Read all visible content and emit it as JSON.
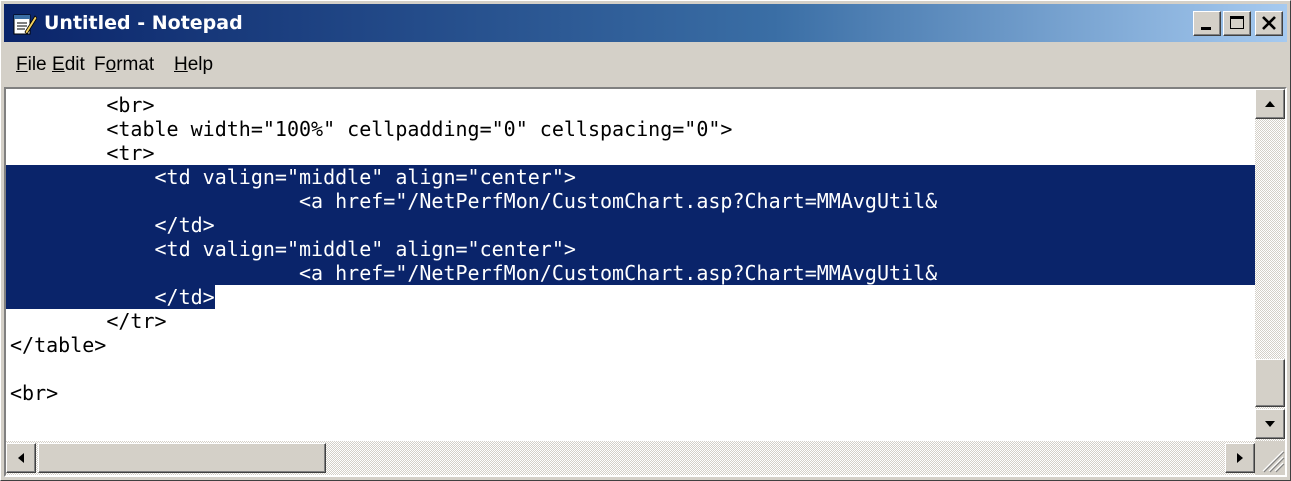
{
  "window": {
    "title": "Untitled - Notepad",
    "icon": "notepad-icon",
    "controls": [
      "minimize-icon",
      "maximize-icon",
      "close-icon"
    ]
  },
  "menu": {
    "file": {
      "mnemonic": "F",
      "rest": "ile"
    },
    "edit": {
      "mnemonic": "E",
      "rest": "dit"
    },
    "format": {
      "pre": "F",
      "mnemonic": "o",
      "rest": "rmat"
    },
    "help": {
      "mnemonic": "H",
      "rest": "elp"
    }
  },
  "editor": {
    "lines": [
      {
        "text": "        <br>",
        "selected": false
      },
      {
        "text": "        <table width=\"100%\" cellpadding=\"0\" cellspacing=\"0\">",
        "selected": false
      },
      {
        "text": "        <tr>",
        "selected": false
      },
      {
        "text": "            <td valign=\"middle\" align=\"center\">",
        "selected": true
      },
      {
        "text": "                        <a href=\"/NetPerfMon/CustomChart.asp?Chart=MMAvgUtil&",
        "selected": true
      },
      {
        "text": "            </td>",
        "selected": true
      },
      {
        "text": "            <td valign=\"middle\" align=\"center\">",
        "selected": true
      },
      {
        "text": "                        <a href=\"/NetPerfMon/CustomChart.asp?Chart=MMAvgUtil&",
        "selected": true
      },
      {
        "text": "            </td>",
        "selected": true
      },
      {
        "text": "        </tr>",
        "selected": false
      },
      {
        "text": "</table>",
        "selected": false
      },
      {
        "text": "",
        "selected": false
      },
      {
        "text": "<br>",
        "selected": false
      }
    ],
    "selection_color": "#0a246a",
    "selection_text_color": "#ffffff"
  },
  "scrollbars": {
    "vertical_icons": [
      "arrow-up-icon",
      "arrow-down-icon"
    ],
    "horizontal_icons": [
      "arrow-left-icon",
      "arrow-right-icon"
    ]
  }
}
